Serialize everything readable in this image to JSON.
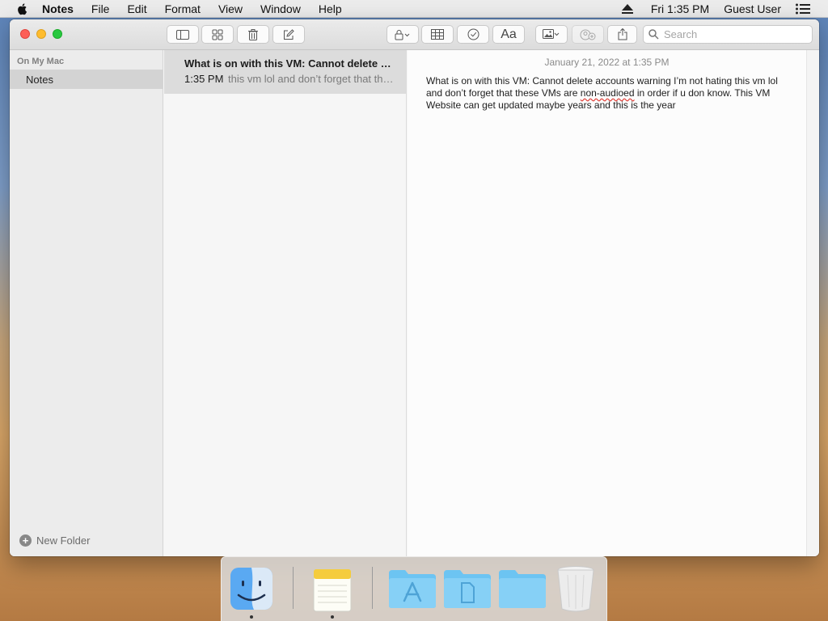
{
  "menubar": {
    "app_name": "Notes",
    "menus": [
      "File",
      "Edit",
      "Format",
      "View",
      "Window",
      "Help"
    ],
    "clock": "Fri 1:35 PM",
    "user": "Guest User"
  },
  "toolbar": {
    "search_placeholder": "Search",
    "format_label": "Aa"
  },
  "sidebar": {
    "section_label": "On My Mac",
    "folder_label": "Notes",
    "new_folder_label": "New Folder"
  },
  "note_list": {
    "items": [
      {
        "title": "What is on with this VM: Cannot delete accounts warning I’m not hating this vm lol and don’t forget that these VMs are non-audioed in order if u don know.",
        "time": "1:35 PM",
        "preview": "this vm lol and don’t forget that these VMs are non-audioed in order if u don know."
      }
    ]
  },
  "editor": {
    "date": "January 21, 2022 at 1:35 PM",
    "body_before": "What is on with this VM:  Cannot delete accounts warning I’m not hating this vm lol and don’t forget that these VMs are ",
    "body_misspelled": "non-audioed",
    "body_after": " in order if u don know. This VM Website can get updated maybe years and this is the year"
  },
  "dock": {
    "items": [
      "finder-icon",
      "notes-app-icon",
      "applications-folder-icon",
      "documents-folder-icon",
      "downloads-folder-icon",
      "trash-icon"
    ]
  },
  "colors": {
    "close": "#fd5f57",
    "minimize": "#febc2e",
    "maximize": "#28c840",
    "selected_note": "#dcdcdc",
    "sidebar_selected": "#d3d3d3",
    "folder_blue": "#6cc4f2"
  }
}
